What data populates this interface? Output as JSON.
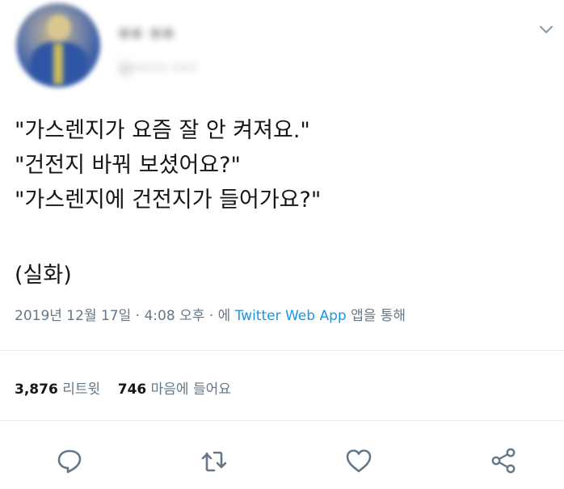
{
  "author": {
    "name": "•• ••",
    "handle": "@•••• •••"
  },
  "tweet": {
    "lines": [
      "\"가스렌지가 요즘 잘 안 켜져요.\"",
      "\"건전지 바꿔 보셨어요?\"",
      "\"가스렌지에 건전지가 들어가요?\"",
      "(실화)"
    ]
  },
  "meta": {
    "date": "2019년 12월 17일",
    "separator": " · ",
    "time": "4:08 오후",
    "via_prefix": "에 ",
    "app": "Twitter Web App",
    "via_suffix": " 앱을 통해"
  },
  "stats": {
    "retweets_count": "3,876",
    "retweets_label": "리트윗",
    "likes_count": "746",
    "likes_label": "마음에 들어요"
  },
  "icons": {
    "menu": "chevron-down-icon",
    "reply": "reply-icon",
    "retweet": "retweet-icon",
    "like": "heart-icon",
    "share": "share-icon"
  },
  "colors": {
    "text": "#14171a",
    "secondary": "#657786",
    "link": "#1b95e0",
    "divider": "#e6ecf0",
    "icon": "#657786"
  }
}
